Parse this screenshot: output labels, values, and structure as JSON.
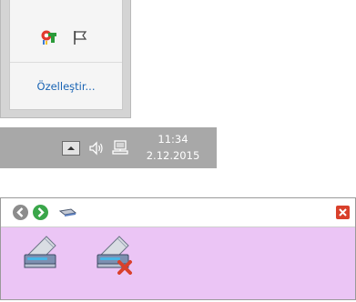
{
  "tray_flyout": {
    "icons": [
      {
        "name": "app-tray-icon",
        "label": ""
      },
      {
        "name": "flag-icon",
        "label": ""
      }
    ],
    "customize_label": "Özelleştir..."
  },
  "taskbar": {
    "time": "11:34",
    "date": "2.12.2015"
  },
  "device_window": {
    "toolbar_icons": [
      "back-icon",
      "forward-icon",
      "device-tool-icon"
    ],
    "devices": [
      {
        "name": "drive-icon",
        "state": "normal"
      },
      {
        "name": "drive-eject-icon",
        "state": "removed"
      }
    ],
    "colors": {
      "body_background": "#ebc5f5",
      "close_red": "#d9402b"
    }
  }
}
